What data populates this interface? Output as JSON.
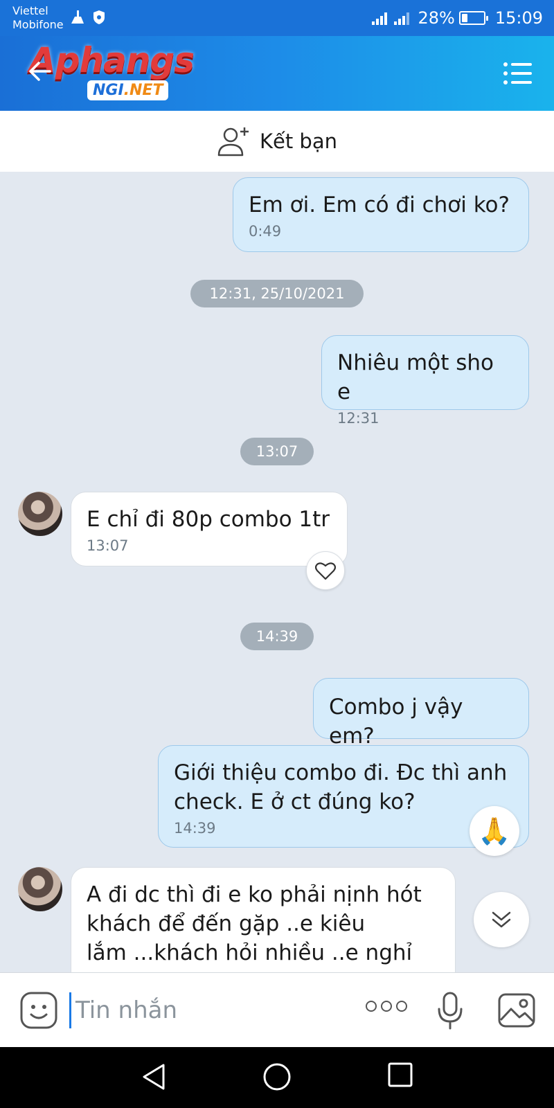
{
  "status_bar": {
    "carrier_1": "Viettel",
    "carrier_2": "Mobifone",
    "battery": "28%",
    "time": "15:09",
    "battery_level": 0.28
  },
  "header": {
    "logo_main": "Aphangs",
    "logo_badge_a": "NGI",
    "logo_badge_b": ".NET",
    "back_icon": "arrow-left-icon",
    "menu_icon": "menu-icon"
  },
  "friend_bar": {
    "label": "Kết bạn",
    "icon": "add-user-icon"
  },
  "messages": [
    {
      "type": "out",
      "text": "Em ơi. Em có đi chơi ko?",
      "time": "0:49"
    },
    {
      "type": "divider",
      "text": "12:31, 25/10/2021"
    },
    {
      "type": "out",
      "text": "Nhiêu một sho e",
      "time": "12:31"
    },
    {
      "type": "divider",
      "text": "13:07"
    },
    {
      "type": "in",
      "text": "E chỉ đi 80p combo 1tr",
      "time": "13:07"
    },
    {
      "type": "divider",
      "text": "14:39"
    },
    {
      "type": "out",
      "text": "Combo j vậy em?"
    },
    {
      "type": "out",
      "text_line1": "Giới thiệu combo đi. Đc thì anh",
      "text_line2": "check. E ở ct đúng ko?",
      "time": "14:39",
      "reaction": "🙏"
    },
    {
      "type": "in",
      "text_line1": "A đi dc thì đi e ko phải nịnh hót",
      "text_line2": "khách để đến gặp ..e kiêu",
      "text_line3": "lắm ...khách hỏi nhiều ..e nghỉ nt"
    }
  ],
  "input_bar": {
    "placeholder": "Tin nhắn",
    "sticker_icon": "sticker-icon",
    "more_icon": "more-icon",
    "mic_icon": "microphone-icon",
    "photo_icon": "photo-icon"
  },
  "nav_bar": {
    "back_icon": "nav-back-icon",
    "home_icon": "nav-home-icon",
    "recent_icon": "nav-recent-icon"
  },
  "colors": {
    "header_start": "#1a6fd6",
    "header_end": "#1ab3ec",
    "outgoing_bubble": "#d6ecfb",
    "incoming_bubble": "#ffffff",
    "chat_background": "#e2e8f0",
    "divider_pill": "#a4afb9"
  }
}
